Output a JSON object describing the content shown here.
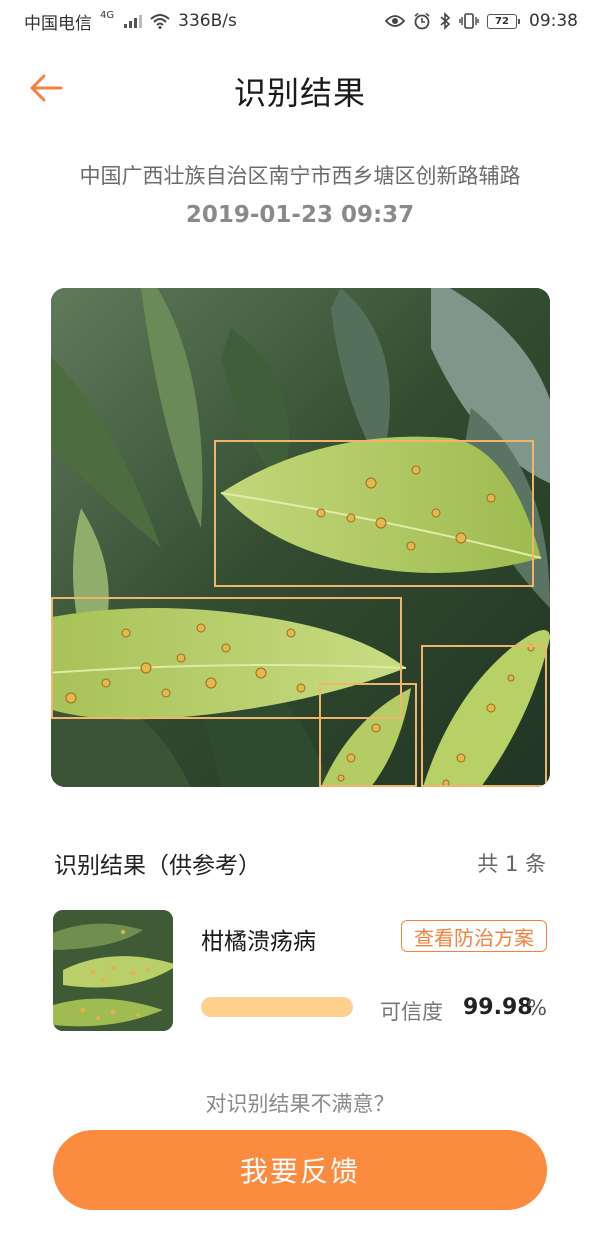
{
  "status_bar": {
    "carrier": "中国电信",
    "network": "4G",
    "speed": "336B/s",
    "battery": "72",
    "time": "09:38"
  },
  "header": {
    "title": "识别结果",
    "back_icon": "arrow-left-icon"
  },
  "location": "中国广西壮族自治区南宁市西乡塘区创新路辅路",
  "datetime": "2019-01-23 09:37",
  "results": {
    "title": "识别结果（供参考）",
    "count": "共 1 条",
    "items": [
      {
        "name": "柑橘溃疡病",
        "plan_label": "查看防治方案",
        "confidence_label": "可信度",
        "confidence_value": "99.98",
        "confidence_unit": "%",
        "confidence_fraction": 0.9998
      }
    ]
  },
  "unsatisfied_text": "对识别结果不满意？",
  "feedback_label": "我要反馈",
  "colors": {
    "accent": "#fb8b3f",
    "confidence_bar": "#fdd08d",
    "detection_box": "#f0b56a"
  }
}
